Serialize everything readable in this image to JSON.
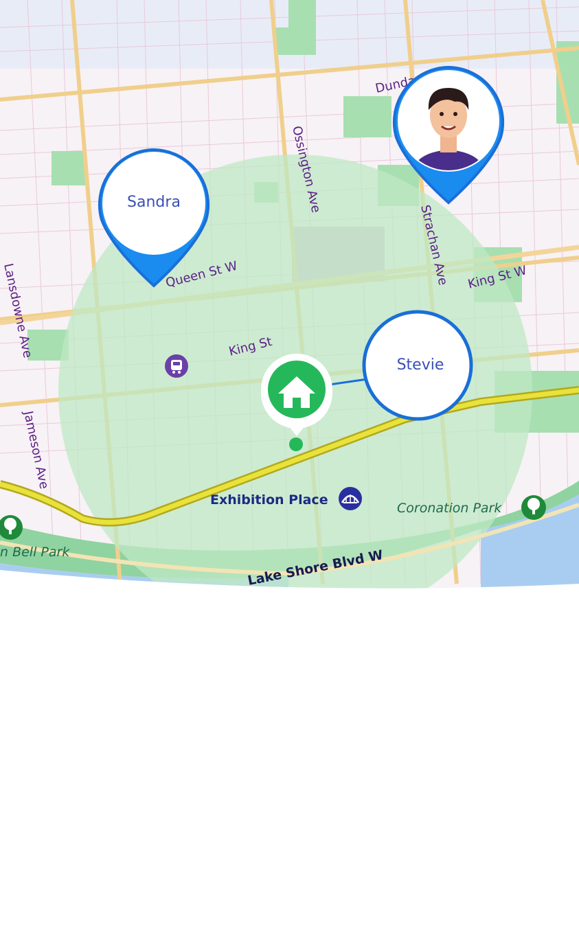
{
  "map": {
    "streets": {
      "dundas": "Dundas St W",
      "ossington": "Ossington Ave",
      "strachan": "Strachan Ave",
      "queen": "Queen St W",
      "king_east": "King St W",
      "king": "King St",
      "jameson": "Jameson Ave",
      "lansdowne": "Lansdowne Ave",
      "lakeshore": "Lake Shore Blvd W"
    },
    "places": {
      "exhibition": "Exhibition Place",
      "coronation": "Coronation Park",
      "bell_park": "n Bell Park"
    },
    "colors": {
      "pin_blue": "#1a6fd8",
      "geofence": "#bfe8c4",
      "home_green": "#25b85a",
      "highway": "#e4d62a",
      "water": "#a9cdf0",
      "park": "#a7dfb1"
    }
  },
  "markers": {
    "sandra": {
      "name": "Sandra"
    },
    "stevie": {
      "name": "Stevie"
    },
    "avatar": {
      "icon": "person-avatar-icon"
    },
    "home": {
      "icon": "home-icon"
    }
  }
}
